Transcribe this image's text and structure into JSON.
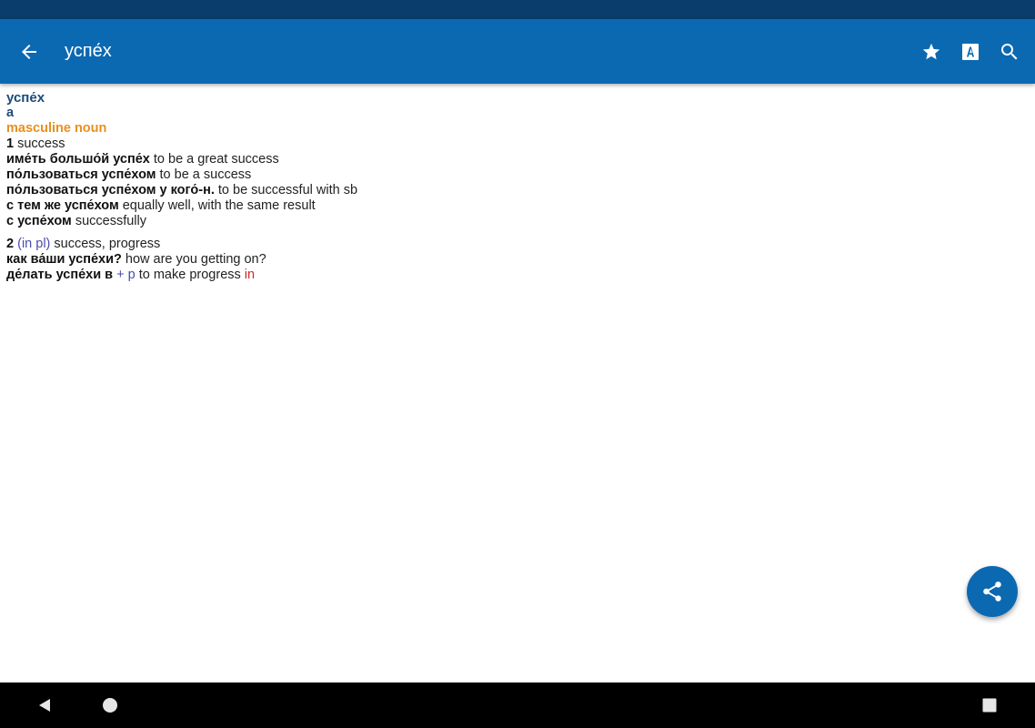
{
  "appbar": {
    "title": "успе́х",
    "icons": {
      "back": "arrow-left-icon",
      "favorite": "star-icon",
      "font": "font-size-icon",
      "search": "search-icon"
    },
    "color": "#0b69b2"
  },
  "entry": {
    "headword": "успе́х",
    "stress_label": "a",
    "pos": "masculine noun",
    "sense1": {
      "number": "1",
      "gloss": "success",
      "examples": [
        {
          "ru": "име́ть большо́й успе́х",
          "en": "to be a great success"
        },
        {
          "ru": "по́льзоваться успе́хом",
          "en": "to be a success"
        },
        {
          "ru": "по́льзоваться успе́хом у кого́-н.",
          "en": "to be successful with sb"
        },
        {
          "ru": "с тем же успе́хом",
          "en": "equally well, with the same result"
        },
        {
          "ru": "с успе́хом",
          "en": "successfully"
        }
      ]
    },
    "sense2": {
      "number": "2",
      "note": "(in pl)",
      "gloss": "success, progress",
      "ex1": {
        "ru": "как ва́ши успе́хи?",
        "en": "how are you getting on?"
      },
      "ex2": {
        "ru": "де́лать успе́хи в",
        "grammar": "+ p",
        "en": "to make progress",
        "prep": "in"
      }
    }
  },
  "fab": {
    "icon": "share-icon"
  },
  "navbar": {
    "icons": [
      "back-triangle-icon",
      "home-circle-icon",
      "recents-square-icon"
    ]
  }
}
